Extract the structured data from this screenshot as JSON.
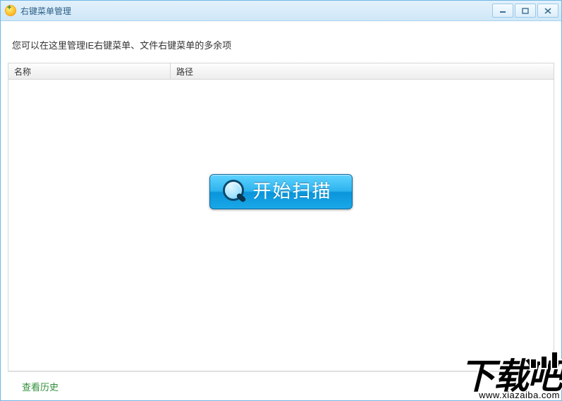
{
  "window": {
    "title": "右键菜单管理"
  },
  "description": "您可以在这里管理IE右键菜单、文件右键菜单的多余项",
  "columns": {
    "name": "名称",
    "path": "路径"
  },
  "scan_button": {
    "label": "开始扫描"
  },
  "footer": {
    "history_link": "查看历史"
  },
  "watermark": {
    "text": "下载吧",
    "url": "www.xiazaiba.com"
  }
}
